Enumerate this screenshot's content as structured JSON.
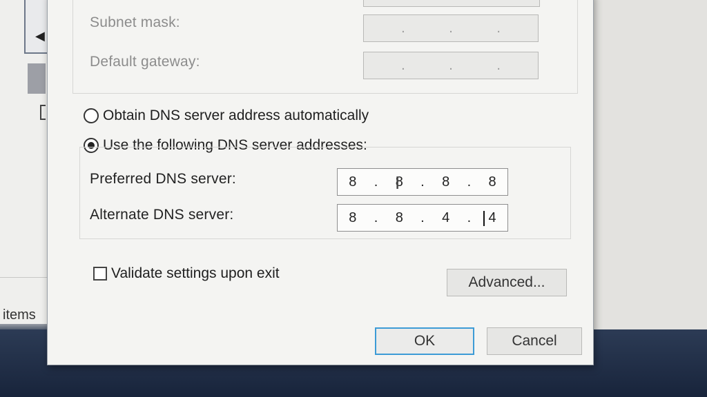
{
  "background": {
    "items_label": "items"
  },
  "dialog": {
    "subnet_mask": {
      "label": "Subnet mask:",
      "octets": [
        "",
        "",
        "",
        ""
      ]
    },
    "default_gateway": {
      "label": "Default gateway:",
      "octets": [
        "",
        "",
        "",
        ""
      ]
    },
    "dns_auto": {
      "label": "Obtain DNS server address automatically",
      "checked": false
    },
    "dns_manual": {
      "label": "Use the following DNS server addresses:",
      "checked": true
    },
    "preferred_dns": {
      "label": "Preferred DNS server:",
      "octets": [
        "8",
        "8",
        "8",
        "8"
      ]
    },
    "alternate_dns": {
      "label": "Alternate DNS server:",
      "octets": [
        "8",
        "8",
        "4",
        "4"
      ]
    },
    "validate": {
      "label": "Validate settings upon exit",
      "checked": false
    },
    "advanced_button": "Advanced...",
    "ok_button": "OK",
    "cancel_button": "Cancel"
  },
  "colors": {
    "focus_border": "#3c9bd6",
    "dialog_bg": "#f4f4f2",
    "taskbar": "#1c2a42"
  }
}
